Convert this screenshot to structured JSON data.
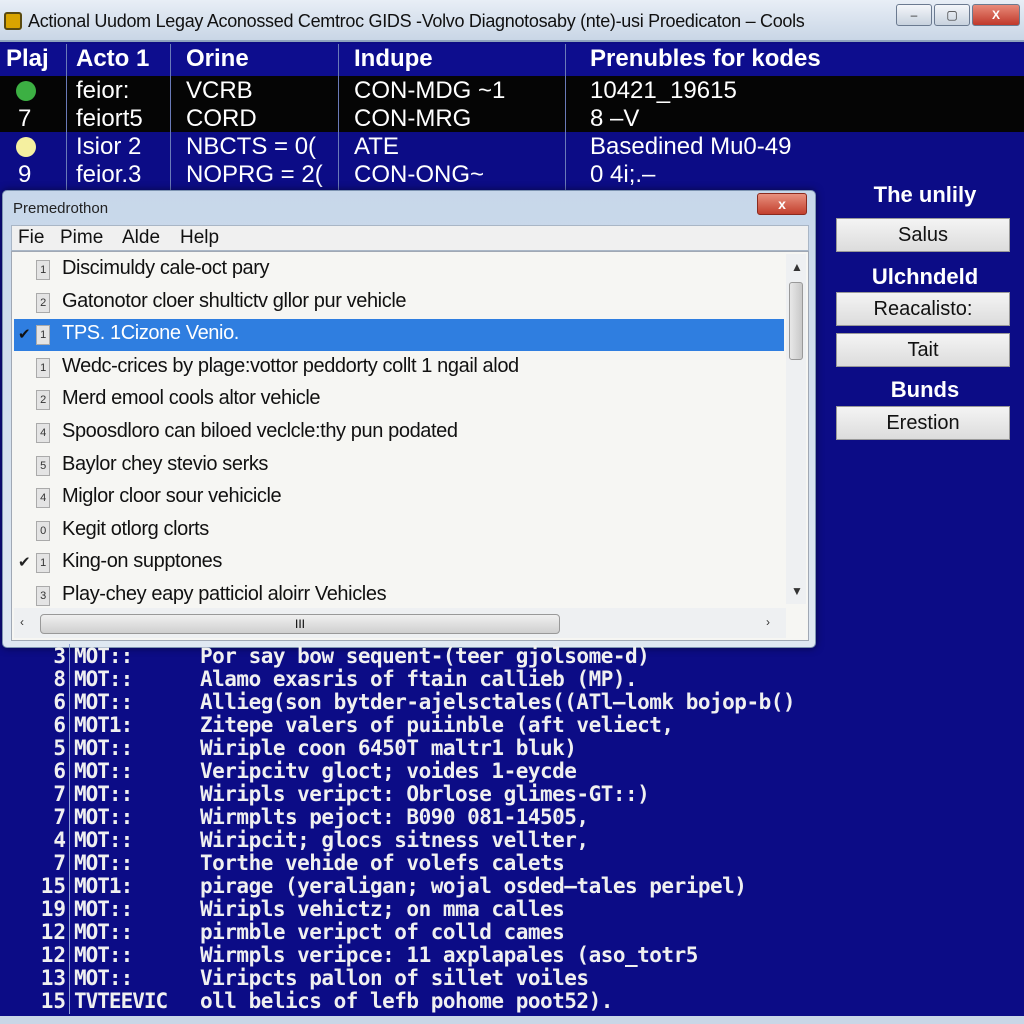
{
  "window": {
    "title": "Actional Uudom Legay Aconossed Cemtroc GIDS -Volvo Diagnotosaby (nte)-usi Proedicaton – Cools",
    "minimize": "–",
    "maximize": "▢",
    "close": "X"
  },
  "grid": {
    "headers": [
      "Plaj",
      "Acto 1",
      "Orine",
      "Indupe",
      "Prenubles for kodes"
    ],
    "rows": [
      {
        "status": "green",
        "cells": [
          "",
          "feior:",
          "VCRB",
          "CON-MDG ~1",
          "10421_19615"
        ]
      },
      {
        "status": "",
        "cells": [
          "7",
          "feiort5",
          "CORD",
          "CON-MRG",
          "8 –V"
        ]
      },
      {
        "status": "yellow",
        "cells": [
          "",
          "Isior 2",
          "NBCTS = 0(",
          "ATE",
          "Basedined Mu0-49"
        ]
      },
      {
        "status": "",
        "cells": [
          "9",
          "feior.3",
          "NOPRG = 2(",
          "CON-ONG~",
          "0 4i;.–"
        ]
      }
    ]
  },
  "dialog": {
    "title": "Premedrothon",
    "close": "x",
    "menu": [
      "Fie",
      "Pime",
      "Alde",
      "Help"
    ],
    "items": [
      {
        "num": "1",
        "text": "Discimuldy cale-oct pary",
        "checked": false,
        "selected": false
      },
      {
        "num": "2",
        "text": "Gatonotor cloer shultictv gllor pur vehicle",
        "checked": false,
        "selected": false
      },
      {
        "num": "1",
        "text": "TPS. 1Cizone Venio.",
        "checked": true,
        "selected": true
      },
      {
        "num": "1",
        "text": "Wedc-crices by plage:vottor peddorty collt 1 ngail alod",
        "checked": false,
        "selected": false
      },
      {
        "num": "2",
        "text": "Merd emool cools altor vehicle",
        "checked": false,
        "selected": false
      },
      {
        "num": "4",
        "text": "Spoosdloro can biloed veclcle:thy pun podated",
        "checked": false,
        "selected": false
      },
      {
        "num": "5",
        "text": "Baylor chey stevio serks",
        "checked": false,
        "selected": false
      },
      {
        "num": "4",
        "text": "Miglor cloor sour vehicicle",
        "checked": false,
        "selected": false
      },
      {
        "num": "0",
        "text": "Kegit otlorg clorts",
        "checked": false,
        "selected": false
      },
      {
        "num": "1",
        "text": "King-on supptones",
        "checked": true,
        "selected": false
      },
      {
        "num": "3",
        "text": "Play-chey eapy patticiol aloirr Vehicles",
        "checked": false,
        "selected": false
      }
    ],
    "hscroll_grip": "III"
  },
  "side": {
    "label1": "The unlily",
    "btn1": "Salus",
    "label2": "Ulchndeld",
    "btn2": "Reacalisto:",
    "btn3": "Tait",
    "label3": "Bunds",
    "btn4": "Erestion"
  },
  "console": [
    {
      "n": "3",
      "tag": "MOT::",
      "text": "Por say bow sequent-(teer gjolsome-d)"
    },
    {
      "n": "8",
      "tag": "MOT::",
      "text": "Alamo exasris of ftain callieb (MP)."
    },
    {
      "n": "6",
      "tag": "MOT::",
      "text": "Allieg(son bytder-ajelsctales((ATl–lomk bojop-b()"
    },
    {
      "n": "6",
      "tag": "MOT1:",
      "text": "Zitepe valers of puiinble (aft veliect,"
    },
    {
      "n": "5",
      "tag": "MOT::",
      "text": "Wiriple coon 6450T maltr1 bluk)"
    },
    {
      "n": "6",
      "tag": "MOT::",
      "text": "Veripcitv gloct; voides 1-eycde"
    },
    {
      "n": "7",
      "tag": "MOT::",
      "text": "Wiripls veripct: Obrlose glimes-GT::)"
    },
    {
      "n": "7",
      "tag": "MOT::",
      "text": "Wirmplts pejoct: B090 081-14505,"
    },
    {
      "n": "4",
      "tag": "MOT::",
      "text": "Wiripcit; glocs sitness vellter,"
    },
    {
      "n": "7",
      "tag": "MOT::",
      "text": "Torthe vehide of volefs calets"
    },
    {
      "n": "15",
      "tag": "MOT1:",
      "text": "pirage (yeraligan; wojal osded–tales peripel)"
    },
    {
      "n": "19",
      "tag": "MOT::",
      "text": "Wiripls vehictz; on mma calles"
    },
    {
      "n": "12",
      "tag": "MOT::",
      "text": "pirmble veripct of colld cames"
    },
    {
      "n": "12",
      "tag": "MOT::",
      "text": "Wirmpls veripce: 11 axplapales (aso_totr5"
    },
    {
      "n": "13",
      "tag": "MOT::",
      "text": "Viripcts pallon of sillet voiles"
    },
    {
      "n": "15",
      "tag": "TVTEEVIC",
      "text": "oll belics of lefb pohome poot52)."
    }
  ],
  "colors": {
    "background": "#0c0c86",
    "selection": "#2f7ee0",
    "status_green": "#3cb043",
    "status_yellow": "#f5f0a0"
  }
}
